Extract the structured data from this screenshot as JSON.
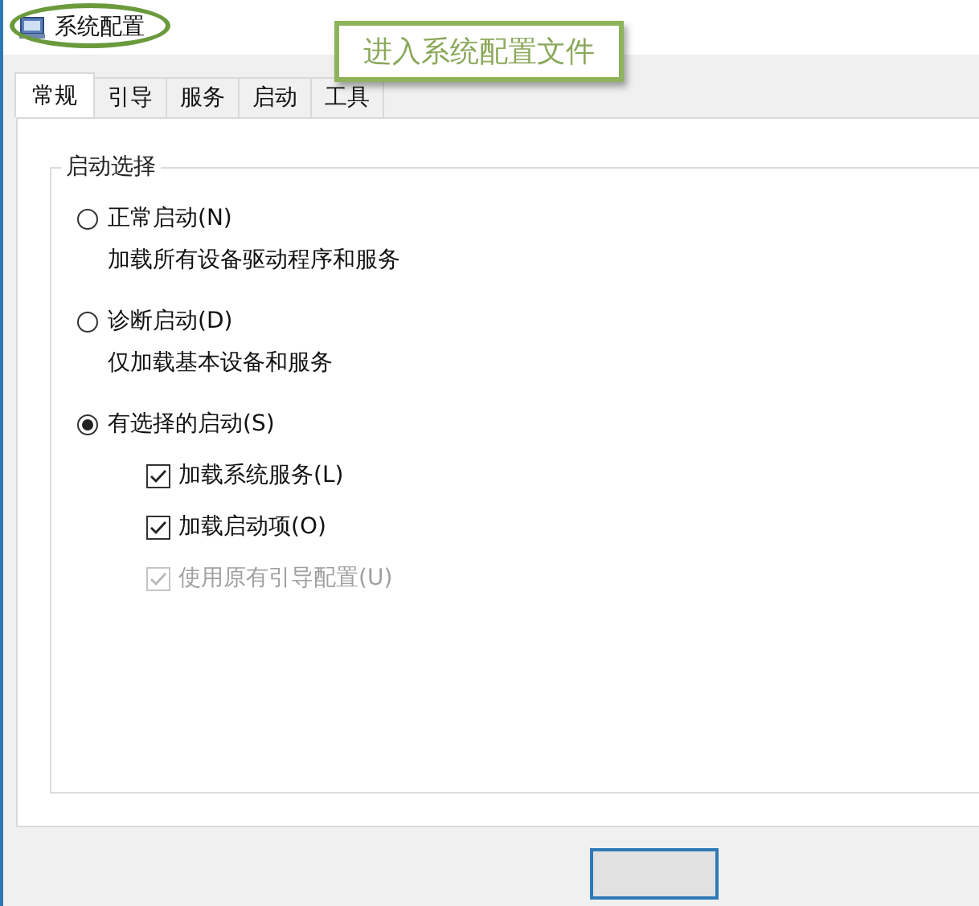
{
  "window": {
    "title": "系统配置"
  },
  "annotation": {
    "text": "进入系统配置文件"
  },
  "tabs": [
    {
      "label": "常规",
      "selected": true
    },
    {
      "label": "引导",
      "selected": false
    },
    {
      "label": "服务",
      "selected": false
    },
    {
      "label": "启动",
      "selected": false
    },
    {
      "label": "工具",
      "selected": false
    }
  ],
  "group": {
    "title": "启动选择"
  },
  "options": [
    {
      "label": "正常启动(N)",
      "selected": false,
      "description": "加载所有设备驱动程序和服务"
    },
    {
      "label": "诊断启动(D)",
      "selected": false,
      "description": "仅加载基本设备和服务"
    },
    {
      "label": "有选择的启动(S)",
      "selected": true
    }
  ],
  "checkboxes": [
    {
      "label": "加载系统服务(L)",
      "checked": true,
      "disabled": false
    },
    {
      "label": "加载启动项(O)",
      "checked": true,
      "disabled": false
    },
    {
      "label": "使用原有引导配置(U)",
      "checked": true,
      "disabled": true
    }
  ]
}
